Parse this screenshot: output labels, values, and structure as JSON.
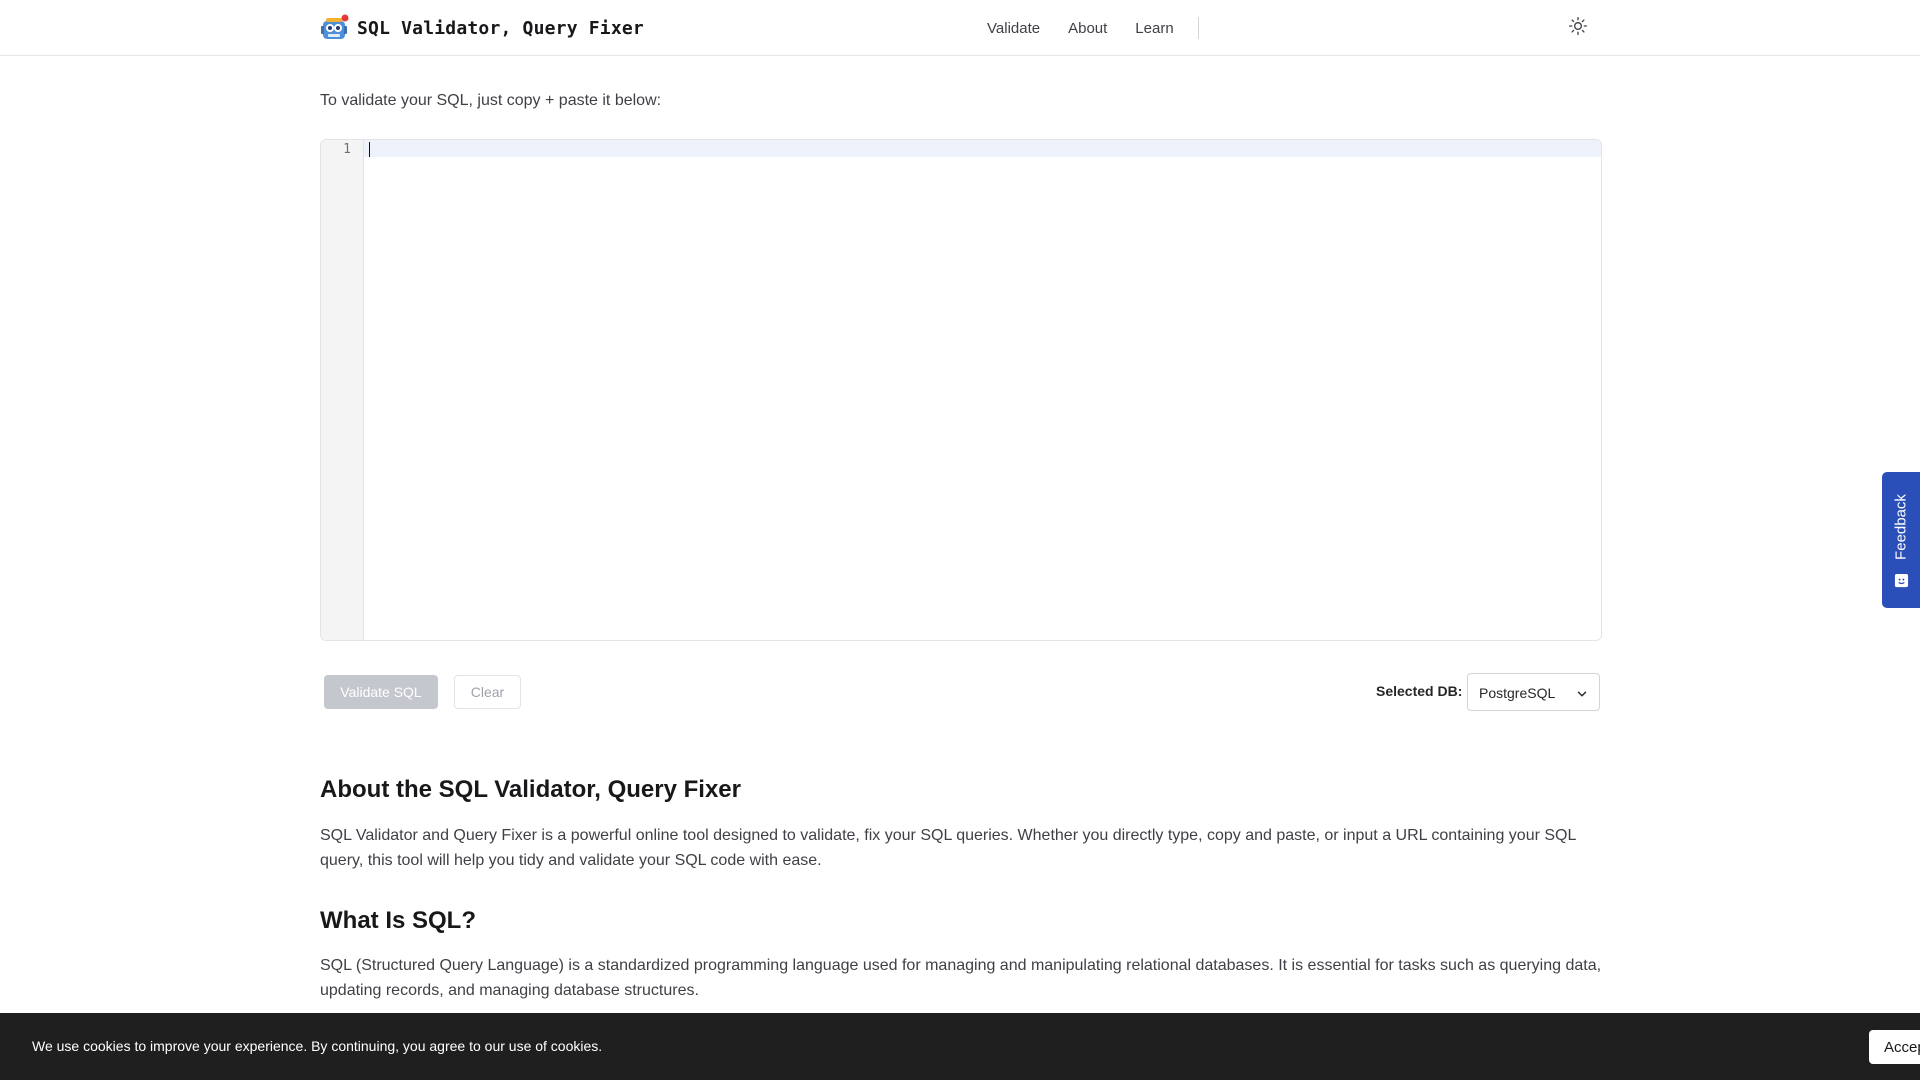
{
  "header": {
    "title": "SQL Validator, Query Fixer",
    "logo_icon": "robot-logo-icon",
    "nav": [
      "Validate",
      "About",
      "Learn"
    ],
    "theme_icon": "sun-icon"
  },
  "intro": "To validate your SQL, just copy + paste it below:",
  "editor": {
    "line_numbers": [
      "1"
    ],
    "content": ""
  },
  "actions": {
    "validate_label": "Validate SQL",
    "clear_label": "Clear",
    "db_label": "Selected DB:",
    "db_selected": "PostgreSQL"
  },
  "sections": [
    {
      "heading": "About the SQL Validator, Query Fixer",
      "body": "SQL Validator and Query Fixer is a powerful online tool designed to validate, fix your SQL queries. Whether you directly type, copy and paste, or input a URL containing your SQL query, this tool will help you tidy and validate your SQL code with ease."
    },
    {
      "heading": "What Is SQL?",
      "body": "SQL (Structured Query Language) is a standardized programming language used for managing and manipulating relational databases. It is essential for tasks such as querying data, updating records, and managing database structures."
    }
  ],
  "feedback": {
    "label": "Feedback",
    "icon": "feedback-icon"
  },
  "cookie": {
    "text": "We use cookies to improve your experience. By continuing, you agree to our use of cookies.",
    "accept_label": "Accept"
  },
  "colors": {
    "feedback_bg": "#2b4fb8",
    "cookie_bg": "#1f1f1f",
    "validate_disabled_bg": "#c4c7cd"
  }
}
